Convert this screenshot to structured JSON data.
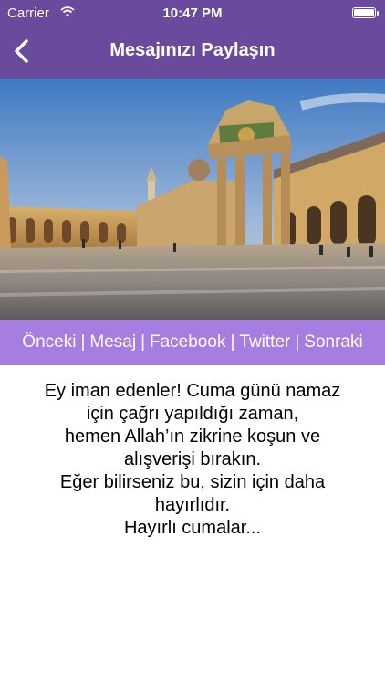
{
  "status_bar": {
    "carrier": "Carrier",
    "time": "10:47 PM"
  },
  "nav": {
    "title": "Mesajınızı Paylaşın",
    "back_icon": "chevron-left-icon"
  },
  "links": {
    "previous": "Önceki",
    "message": "Mesaj",
    "facebook": "Facebook",
    "twitter": "Twitter",
    "next": "Sonraki",
    "separator": "|"
  },
  "message_lines": [
    "Ey iman edenler! Cuma günü namaz",
    "için çağrı yapıldığı zaman,",
    "hemen Allah’ın zikrine koşun ve",
    "alışverişi bırakın.",
    "Eğer bilirseniz bu, sizin için daha",
    "hayırlıdır.",
    "Hayırlı cumalar..."
  ],
  "colors": {
    "nav_bar": "#6a4a9c",
    "link_bar": "#a67de0",
    "text": "#000000"
  }
}
